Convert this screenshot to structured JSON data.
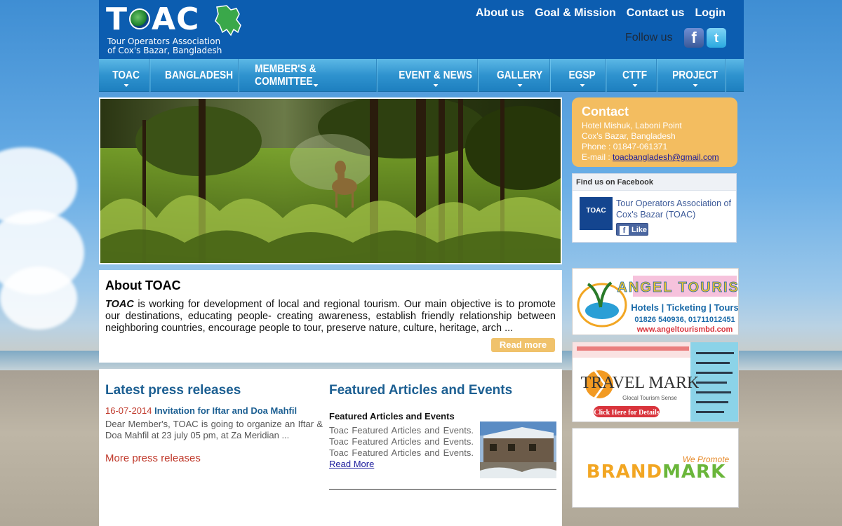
{
  "header": {
    "logo_text": "TOAC",
    "logo_subtitle_line1": "Tour Operators Association",
    "logo_subtitle_line2": "of Cox's Bazar, Bangladesh",
    "top_links": [
      "About us",
      "Goal & Mission",
      "Contact us",
      "Login"
    ],
    "follow_label": "Follow us",
    "facebook_glyph": "f",
    "twitter_glyph": "t"
  },
  "nav": {
    "items": [
      "TOAC",
      "BANGLADESH",
      "MEMBER'S & COMMITTEE",
      "EVENT & NEWS",
      "GALLERY",
      "EGSP",
      "CTTF",
      "PROJECT"
    ]
  },
  "about": {
    "heading": "About TOAC",
    "lead": "TOAC",
    "text": " is working for development of local and regional tourism. Our main objective is to promote our destinations, educating people- creating awareness, establish friendly relationship between neighboring countries, encourage people to tour, preserve nature, culture, heritage, arch ...",
    "read_more": "Read more"
  },
  "press": {
    "heading": "Latest press releases",
    "date": "16-07-2014",
    "title": "Invitation for Iftar and Doa Mahfil",
    "desc": "Dear Member's, TOAC is going to organize an Iftar & Doa Mahfil at 23 july 05 pm, at Za Meridian ...",
    "more": "More press releases"
  },
  "featured": {
    "heading": "Featured Articles and Events",
    "subheading": "Featured Articles and Events",
    "desc": "Toac Featured Articles and Events. Toac Featured Articles and Events. Toac Featured Articles and Events.",
    "read_more": "Read More"
  },
  "contact": {
    "heading": "Contact",
    "line1": "Hotel Mishuk, Laboni Point",
    "line2": "Cox's Bazar, Bangladesh",
    "phone_label": "Phone :",
    "phone": "01847-061371",
    "email_label": "E-mail :",
    "email": "toacbangladesh@gmail.com"
  },
  "facebook_box": {
    "header": "Find us on Facebook",
    "logo_text": "TOAC",
    "page_name": "Tour Operators Association of Cox's Bazar (TOAC)",
    "like": "Like"
  },
  "ads": {
    "angel_title": "ANGEL TOURISM",
    "angel_services": "Hotels | Ticketing | Tours",
    "angel_phone": "01826 540936, 01711012451",
    "angel_web": "www.angeltourismbd.com",
    "travel_name": "TRAVEL MARK",
    "travel_tagline": "Glocal Tourism Sense",
    "travel_cta": "Click Here for Details",
    "brand_tagline": "We Promote",
    "brand_name_1": "BRAND",
    "brand_name_2": "MARK"
  },
  "colors": {
    "header_bg": "#0c5db0",
    "nav_bg": "#2f93cf",
    "contact_bg": "#f3bd60",
    "heading_blue": "#1c5f92",
    "date_red": "#c0392b"
  }
}
